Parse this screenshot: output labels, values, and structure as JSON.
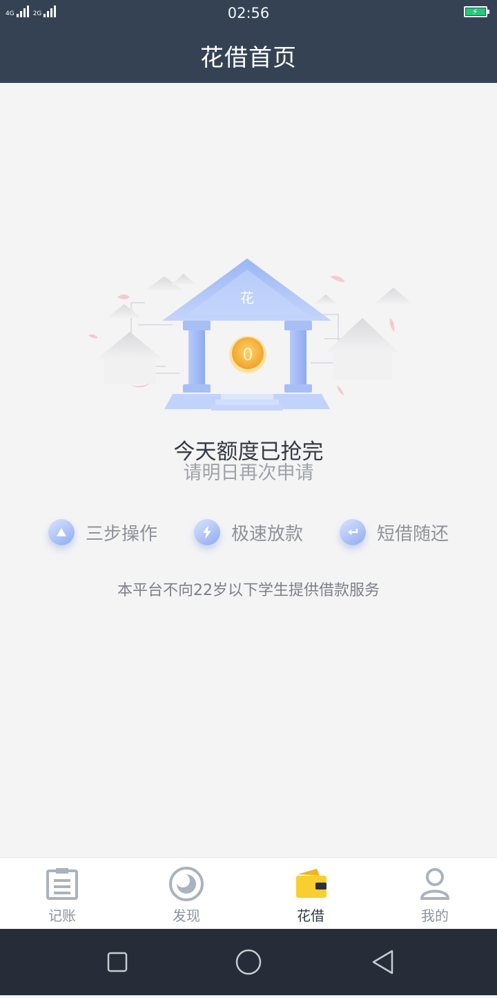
{
  "status_bar": {
    "sim1_label": "4G",
    "sim2_label": "2G",
    "time": "02:56"
  },
  "header": {
    "title": "花借首页"
  },
  "hero": {
    "coin_label": "0",
    "bank_badge": "花"
  },
  "message": {
    "main": "今天额度已抢完",
    "sub": "请明日再次申请"
  },
  "features": [
    {
      "label": "三步操作",
      "icon": "triangle-icon"
    },
    {
      "label": "极速放款",
      "icon": "lightning-icon"
    },
    {
      "label": "短借随还",
      "icon": "return-arrow-icon"
    }
  ],
  "notice": "本平台不向22岁以下学生提供借款服务",
  "tabbar": {
    "active_index": 2,
    "items": [
      {
        "label": "记账",
        "icon": "notebook-icon"
      },
      {
        "label": "发现",
        "icon": "discover-icon"
      },
      {
        "label": "花借",
        "icon": "wallet-icon"
      },
      {
        "label": "我的",
        "icon": "profile-icon"
      }
    ]
  },
  "colors": {
    "header_bg": "#344254",
    "page_bg": "#f4f4f5",
    "accent_blue": "#8eaaf0",
    "coin_gold": "#f7b23b",
    "wallet_yellow": "#f7cf2f",
    "nav_bg": "#272d38"
  }
}
